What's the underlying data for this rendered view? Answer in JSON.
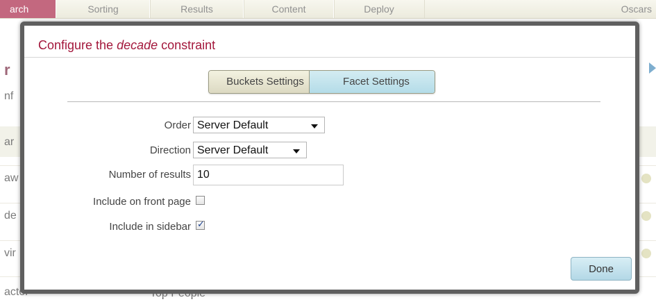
{
  "nav": {
    "tabs": [
      "arch",
      "Sorting",
      "Results",
      "Content",
      "Deploy"
    ],
    "right_label": "Oscars"
  },
  "background": {
    "title_fragment": "r",
    "subtitle_fragment": "nf",
    "band_fragment": "ar",
    "rows": [
      "aw",
      "de",
      "vir",
      "actor"
    ],
    "bottom_cell": "Top People"
  },
  "dialog": {
    "title_prefix": "Configure the ",
    "title_emph": "decade",
    "title_suffix": " constraint",
    "tabs": {
      "buckets": "Buckets Settings",
      "facet": "Facet Settings",
      "active": "Facet Settings"
    },
    "fields": {
      "order": {
        "label": "Order",
        "value": "Server Default"
      },
      "direction": {
        "label": "Direction",
        "value": "Server Default"
      },
      "num_results": {
        "label": "Number of results",
        "value": "10"
      },
      "front_page": {
        "label": "Include on front page",
        "checked": false
      },
      "sidebar": {
        "label": "Include in sidebar",
        "checked": true
      }
    },
    "done_label": "Done"
  }
}
